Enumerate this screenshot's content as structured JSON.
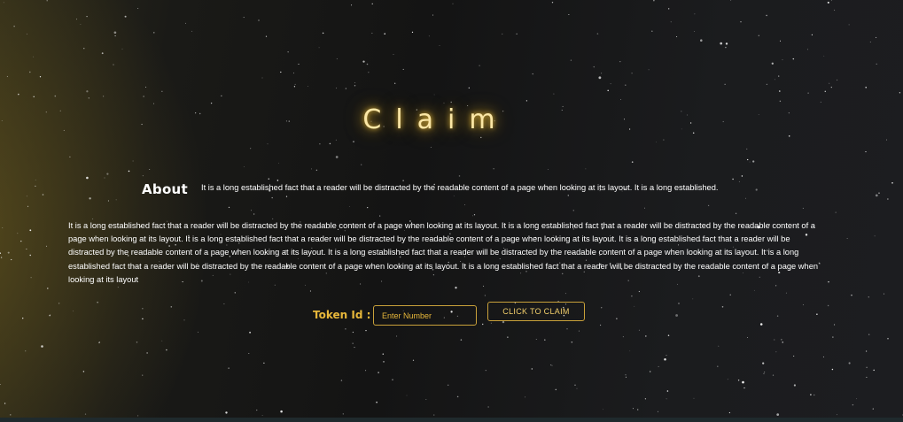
{
  "page": {
    "title": "Claim",
    "accent_color": "#e7b73a",
    "background": "starfield"
  },
  "about": {
    "label": "About",
    "short_text": "It is a long established fact that a reader will be distracted by the readable content of a page when looking at its layout. It is a long established.",
    "long_text": "It is a long established fact that a reader will be distracted by the readable content of a page when looking at its layout. It is a long established fact that a reader will be distracted by the readable content of a page when looking at its layout. It is a long established fact that a reader will be distracted by the readable content of a page when looking at its layout. It is a long established fact that a reader will be distracted by the readable content of a page when looking at its layout. It is a long established fact that a reader will be distracted by the readable content of a page when looking at its layout. It is a long established fact that a reader will be distracted by the readable content of a page when looking at its layout. It is a long established fact that a reader will be distracted by the readable content of a page when looking at its layout"
  },
  "claim_form": {
    "token_label": "Token Id :",
    "token_input_value": "",
    "token_input_placeholder": "Enter Number",
    "claim_button_label": "CLICK TO CLAIM"
  }
}
